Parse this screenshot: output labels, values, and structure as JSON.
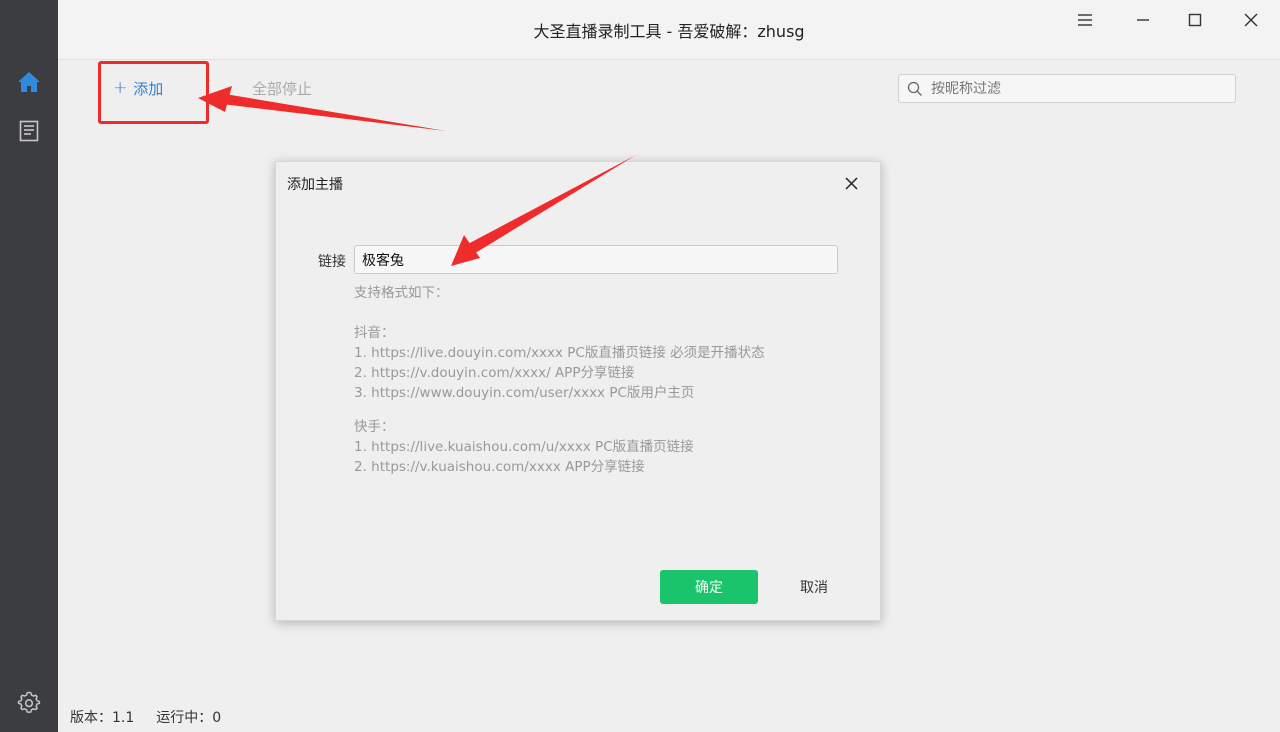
{
  "window": {
    "title": "大圣直播录制工具 - 吾爱破解：zhusg"
  },
  "sidebar": {
    "items": [
      {
        "icon": "home-icon"
      },
      {
        "icon": "notebook-icon"
      },
      {
        "icon": "settings-gear-icon"
      }
    ],
    "accent": "#2f8ae0"
  },
  "toolbar": {
    "add_label": "添加",
    "stop_all_label": "全部停止",
    "filter_placeholder": "按昵称过滤"
  },
  "dialog": {
    "title": "添加主播",
    "link_label": "链接",
    "link_value": "极客兔",
    "help_lines": [
      "支持格式如下：",
      "",
      "抖音：",
      "1. https://live.douyin.com/xxxx PC版直播页链接 必须是开播状态",
      "2. https://v.douyin.com/xxxx/ APP分享链接",
      "3. https://www.douyin.com/user/xxxx PC版用户主页",
      "",
      "快手：",
      "1. https://live.kuaishou.com/u/xxxx PC版直播页链接",
      "2. https://v.kuaishou.com/xxxx APP分享链接"
    ],
    "ok_label": "确定",
    "cancel_label": "取消",
    "ok_color": "#19c46a"
  },
  "statusbar": {
    "version": "版本：1.1",
    "running": "运行中：0"
  },
  "annotation_color": "#ef2b2b"
}
